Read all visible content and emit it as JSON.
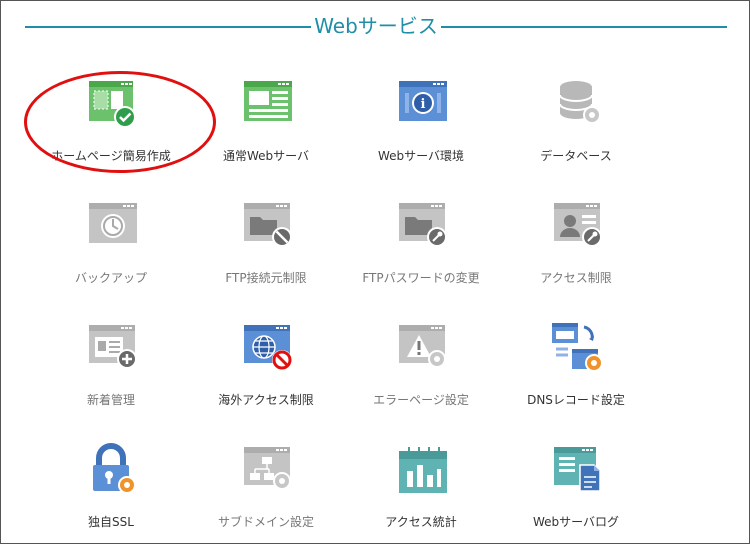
{
  "header": {
    "title": "Webサービス"
  },
  "colors": {
    "accent": "#1f8ea6",
    "highlight": "#e01010",
    "green": "#5cb85c",
    "blue": "#4a7fc9",
    "gray": "#bdbdbd",
    "orange": "#f0932b"
  },
  "tiles": [
    {
      "label": "ホームページ簡易作成",
      "icon": "homepage-builder-icon"
    },
    {
      "label": "通常Webサーバ",
      "icon": "web-server-icon"
    },
    {
      "label": "Webサーバ環境",
      "icon": "server-info-icon"
    },
    {
      "label": "データベース",
      "icon": "database-icon"
    },
    {
      "label": "バックアップ",
      "icon": "backup-icon"
    },
    {
      "label": "FTP接続元制限",
      "icon": "ftp-restrict-icon"
    },
    {
      "label": "FTPパスワードの変更",
      "icon": "ftp-password-icon"
    },
    {
      "label": "アクセス制限",
      "icon": "access-restrict-icon"
    },
    {
      "label": "新着管理",
      "icon": "news-icon"
    },
    {
      "label": "海外アクセス制限",
      "icon": "overseas-access-icon"
    },
    {
      "label": "エラーページ設定",
      "icon": "error-page-icon"
    },
    {
      "label": "DNSレコード設定",
      "icon": "dns-record-icon"
    },
    {
      "label": "独自SSL",
      "icon": "ssl-lock-icon"
    },
    {
      "label": "サブドメイン設定",
      "icon": "subdomain-icon"
    },
    {
      "label": "アクセス統計",
      "icon": "access-stats-icon"
    },
    {
      "label": "Webサーバログ",
      "icon": "server-log-icon"
    }
  ]
}
